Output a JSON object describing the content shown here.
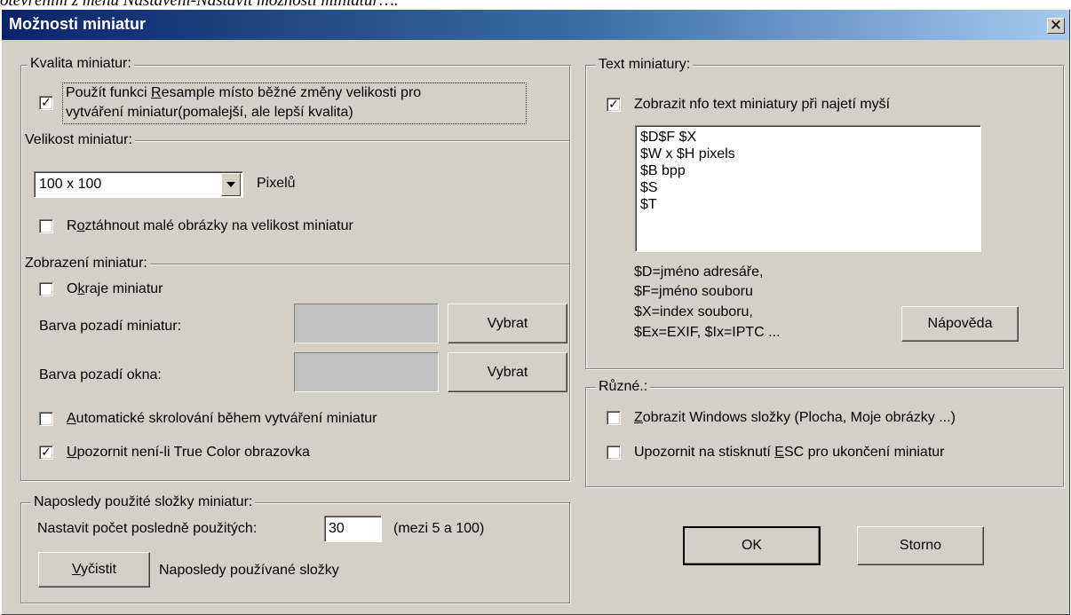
{
  "doc_text": "otevřením z menu Nastavení-Nastavit možnosti miniatur….",
  "window": {
    "title": "Možnosti miniatur",
    "close_glyph": "✕"
  },
  "quality": {
    "legend": "Kvalita miniatur:",
    "resample": {
      "checked": true,
      "line1_pre": "Použít funkci ",
      "line1_key": "R",
      "line1_post": "esample místo běžné změny velikosti pro",
      "line2": "vytváření miniatur(pomalejší, ale lepší kvalita)"
    }
  },
  "size": {
    "legend": "Velikost miniatur:",
    "value": "100 x 100",
    "unit": "Pixelů",
    "stretch": {
      "checked": false,
      "pre": "R",
      "key": "o",
      "post": "ztáhnout malé obrázky na velikost miniatur"
    }
  },
  "display": {
    "legend": "Zobrazení miniatur:",
    "borders": {
      "checked": false,
      "pre": "O",
      "key": "k",
      "post": "raje miniatur"
    },
    "thumb_bg_label": "Barva pozadí miniatur:",
    "window_bg_label": "Barva pozadí okna:",
    "choose1": "Vybrat",
    "choose2": "Vybrat",
    "swatch_color": "#c0c0c0",
    "autoscroll": {
      "checked": false,
      "key": "A",
      "post": "utomatické skrolování během vytváření miniatur"
    },
    "truecolor": {
      "checked": true,
      "key": "U",
      "post": "pozornit není-li True Color obrazovka"
    }
  },
  "recent": {
    "legend": "Naposledy použité složky miniatur:",
    "count_label": "Nastavit počet posledně použitých:",
    "count_value": "30",
    "range": "(mezi 5 a 100)",
    "clear_key": "V",
    "clear_post": "yčistit",
    "folders_label": "Naposledy používané složky"
  },
  "text": {
    "legend": "Text miniatury:",
    "show_info": {
      "checked": true,
      "label": "Zobrazit nfo text miniatury při najetí myší"
    },
    "lines": [
      "$D$F $X",
      "$W x $H pixels",
      "$B bpp",
      "$S",
      "$T"
    ],
    "help_lines": [
      "$D=jméno adresáře,",
      "$F=jméno souboru",
      "$X=index souboru,",
      "$Ex=EXIF, $Ix=IPTC ..."
    ],
    "help_button": "Nápověda"
  },
  "misc": {
    "legend": "Různé.:",
    "windows_folders": {
      "checked": false,
      "key": "Z",
      "post": "obrazit Windows složky (Plocha, Moje obrázky ...)"
    },
    "esc_warn": {
      "checked": false,
      "pre": "Upozornit na stisknutí ",
      "key": "E",
      "post": "SC pro ukončení miniatur"
    }
  },
  "buttons": {
    "ok": "OK",
    "cancel": "Storno"
  },
  "colors": {
    "face": "#d4d0c8",
    "title_start": "#0a246a",
    "title_end": "#a6caf0"
  }
}
